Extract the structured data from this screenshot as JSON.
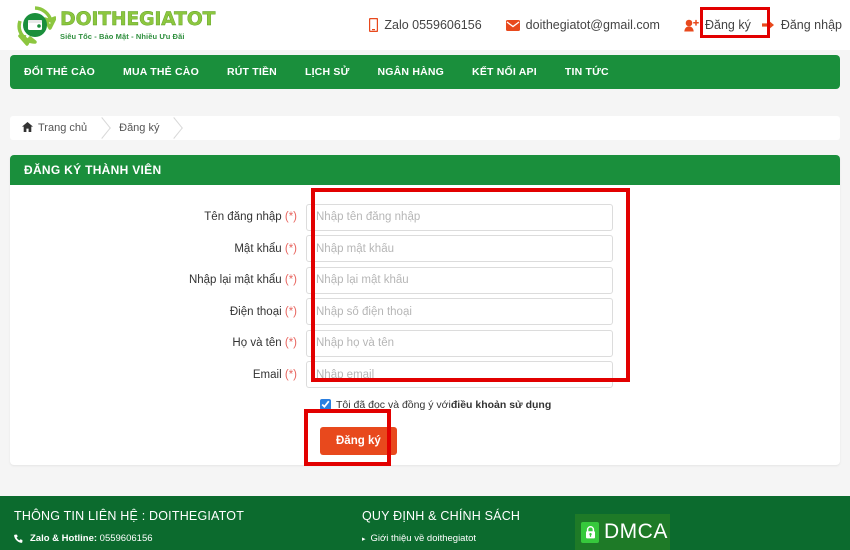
{
  "brand": {
    "name": "DOITHEGIATOT",
    "tagline": "Siêu Tốc - Bảo Mật - Nhiều Ưu Đãi",
    "logo_icon": "wallet-recycle-icon",
    "green": "#1a8f3c",
    "orange": "#e8491d",
    "annotation_red": "#e20000"
  },
  "topbar": {
    "zalo": {
      "icon": "mobile-icon",
      "label": "Zalo 0559606156"
    },
    "email": {
      "icon": "envelope-icon",
      "label": "doithegiatot@gmail.com"
    },
    "register": {
      "icon": "user-plus-icon",
      "label": "Đăng ký"
    },
    "login": {
      "icon": "sign-in-icon",
      "label": "Đăng nhập"
    }
  },
  "nav": {
    "items": [
      {
        "label": "ĐỔI THẺ CÀO"
      },
      {
        "label": "MUA THẺ CÀO"
      },
      {
        "label": "RÚT TIỀN"
      },
      {
        "label": "LỊCH SỬ"
      },
      {
        "label": "NGÂN HÀNG"
      },
      {
        "label": "KẾT NỐI API"
      },
      {
        "label": "TIN TỨC"
      }
    ]
  },
  "breadcrumb": {
    "home_icon": "home-icon",
    "home": "Trang chủ",
    "current": "Đăng ký"
  },
  "panel": {
    "title": "ĐĂNG KÝ THÀNH VIÊN",
    "fields": [
      {
        "label": "Tên đăng nhập",
        "required": "(*)",
        "placeholder": "Nhập tên đăng nhập",
        "value": "",
        "type": "text",
        "name": "username"
      },
      {
        "label": "Mật khẩu",
        "required": "(*)",
        "placeholder": "Nhập mật khẩu",
        "value": "",
        "type": "text",
        "name": "password"
      },
      {
        "label": "Nhập lại mật khẩu",
        "required": "(*)",
        "placeholder": "Nhập lại mật khẩu",
        "value": "",
        "type": "text",
        "name": "password-confirm"
      },
      {
        "label": "Điện thoại",
        "required": "(*)",
        "placeholder": "Nhập số điện thoại",
        "value": "",
        "type": "text",
        "name": "phone"
      },
      {
        "label": "Họ và tên",
        "required": "(*)",
        "placeholder": "Nhập họ và tên",
        "value": "",
        "type": "text",
        "name": "fullname"
      },
      {
        "label": "Email",
        "required": "(*)",
        "placeholder": "Nhập email",
        "value": "",
        "type": "text",
        "name": "email"
      }
    ],
    "terms": {
      "checked": true,
      "text": "Tôi đã đọc và đồng ý với ",
      "link": "điều khoản sử dụng"
    },
    "submit_label": "Đăng ký"
  },
  "footer": {
    "contact_title": "THÔNG TIN LIÊN HỆ : DOITHEGIATOT",
    "hotline_icon": "phone-icon",
    "hotline_label": "Zalo & Hotline:",
    "hotline_value": "0559606156",
    "policy_title": "QUY ĐỊNH & CHÍNH SÁCH",
    "policy_links": [
      {
        "label": "Giới thiệu về doithegiatot"
      }
    ],
    "dmca": {
      "text": "DMCA",
      "icon": "lock-icon"
    }
  }
}
